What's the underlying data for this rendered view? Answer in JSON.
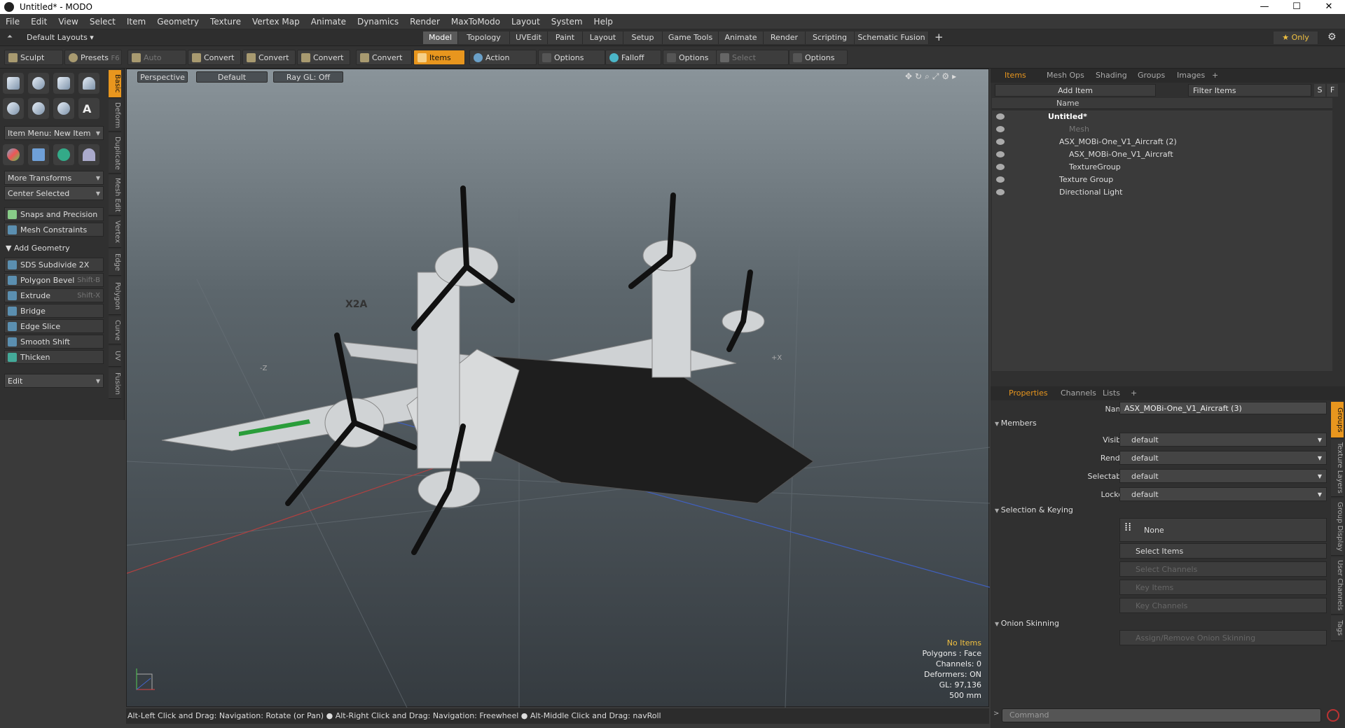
{
  "window": {
    "title": "Untitled* - MODO",
    "min": "—",
    "max": "☐",
    "close": "✕"
  },
  "menu": [
    "File",
    "Edit",
    "View",
    "Select",
    "Item",
    "Geometry",
    "Texture",
    "Vertex Map",
    "Animate",
    "Dynamics",
    "Render",
    "MaxToModo",
    "Layout",
    "System",
    "Help"
  ],
  "layout": {
    "default_layouts": "Default Layouts ▾",
    "tabs": [
      "Model",
      "Topology",
      "UVEdit",
      "Paint",
      "Layout",
      "Setup",
      "Game Tools",
      "Animate",
      "Render",
      "Scripting",
      "Schematic Fusion"
    ],
    "plus": "+",
    "only": "★  Only",
    "gear": "⚙"
  },
  "toolbar": {
    "sculpt": "Sculpt",
    "presets": "Presets",
    "presets_key": "F6",
    "auto_select": "Auto Select",
    "convert1": "Convert",
    "convert2": "Convert",
    "convert3": "Convert",
    "convert4": "Convert",
    "items": "Items",
    "action_center": "Action Center",
    "options1": "Options",
    "falloff": "Falloff",
    "options2": "Options",
    "select_through": "Select Through",
    "options3": "Options"
  },
  "left": {
    "item_menu": "Item Menu: New Item",
    "more_transforms": "More Transforms",
    "center_selected": "Center Selected",
    "snaps": "Snaps and Precision",
    "mesh_constraints": "Mesh Constraints",
    "add_geometry": "Add Geometry",
    "tools": [
      {
        "label": "SDS Subdivide 2X",
        "key": ""
      },
      {
        "label": "Polygon Bevel",
        "key": "Shift-B"
      },
      {
        "label": "Extrude",
        "key": "Shift-X"
      },
      {
        "label": "Bridge",
        "key": ""
      },
      {
        "label": "Edge Slice",
        "key": ""
      },
      {
        "label": "Smooth Shift",
        "key": ""
      },
      {
        "label": "Thicken",
        "key": ""
      }
    ],
    "edit": "Edit",
    "vtabs": [
      "Basic",
      "Deform",
      "Duplicate",
      "Mesh Edit",
      "Vertex",
      "Edge",
      "Polygon",
      "Curve",
      "UV",
      "Fusion"
    ]
  },
  "viewport": {
    "view": "Perspective",
    "shading": "Default",
    "raygl": "Ray GL: Off",
    "info": {
      "items": "No Items",
      "polygons": "Polygons : Face",
      "channels": "Channels: 0",
      "deformers": "Deformers: ON",
      "gl": "GL: 97,136",
      "size": "500 mm"
    },
    "axis_neg_z": "-Z",
    "axis_pos_x": "+X",
    "model_label": "X2A"
  },
  "statusbar": "Alt-Left Click and Drag: Navigation: Rotate (or Pan) ● Alt-Right Click and Drag: Navigation: Freewheel ● Alt-Middle Click and Drag: navRoll",
  "items_panel": {
    "tabs": [
      "Items",
      "Mesh Ops",
      "Shading",
      "Groups",
      "Images",
      "+"
    ],
    "add_item": "Add Item",
    "filter": "Filter Items",
    "s": "S",
    "f": "F",
    "col_name": "Name",
    "tree": [
      {
        "label": "Untitled*",
        "indent": 0
      },
      {
        "label": "Mesh",
        "indent": 1
      },
      {
        "label": "ASX_MOBi-One_V1_Aircraft (2)",
        "indent": 1
      },
      {
        "label": "ASX_MOBi-One_V1_Aircraft",
        "indent": 2
      },
      {
        "label": "TextureGroup",
        "indent": 2
      },
      {
        "label": "Texture Group",
        "indent": 1
      },
      {
        "label": "Directional Light",
        "indent": 1
      }
    ]
  },
  "properties": {
    "tabs": [
      "Properties",
      "Channels",
      "Lists",
      "+"
    ],
    "name_label": "Name",
    "name_value": "ASX_MOBi-One_V1_Aircraft (3)",
    "members": "Members",
    "visible_label": "Visible",
    "visible": "default",
    "render_label": "Render",
    "render": "default",
    "selectable_label": "Selectable",
    "selectable": "default",
    "locked_label": "Locked",
    "locked": "default",
    "selection_keying": "Selection & Keying",
    "none": "None",
    "select_items": "Select Items",
    "select_channels": "Select Channels",
    "key_items": "Key Items",
    "key_channels": "Key Channels",
    "onion": "Onion Skinning",
    "assign_onion": "Assign/Remove Onion Skinning",
    "side_tabs": [
      "Groups",
      "Texture Layers",
      "Group Display",
      "User Channels",
      "Tags"
    ]
  },
  "command": {
    "placeholder": "Command"
  }
}
